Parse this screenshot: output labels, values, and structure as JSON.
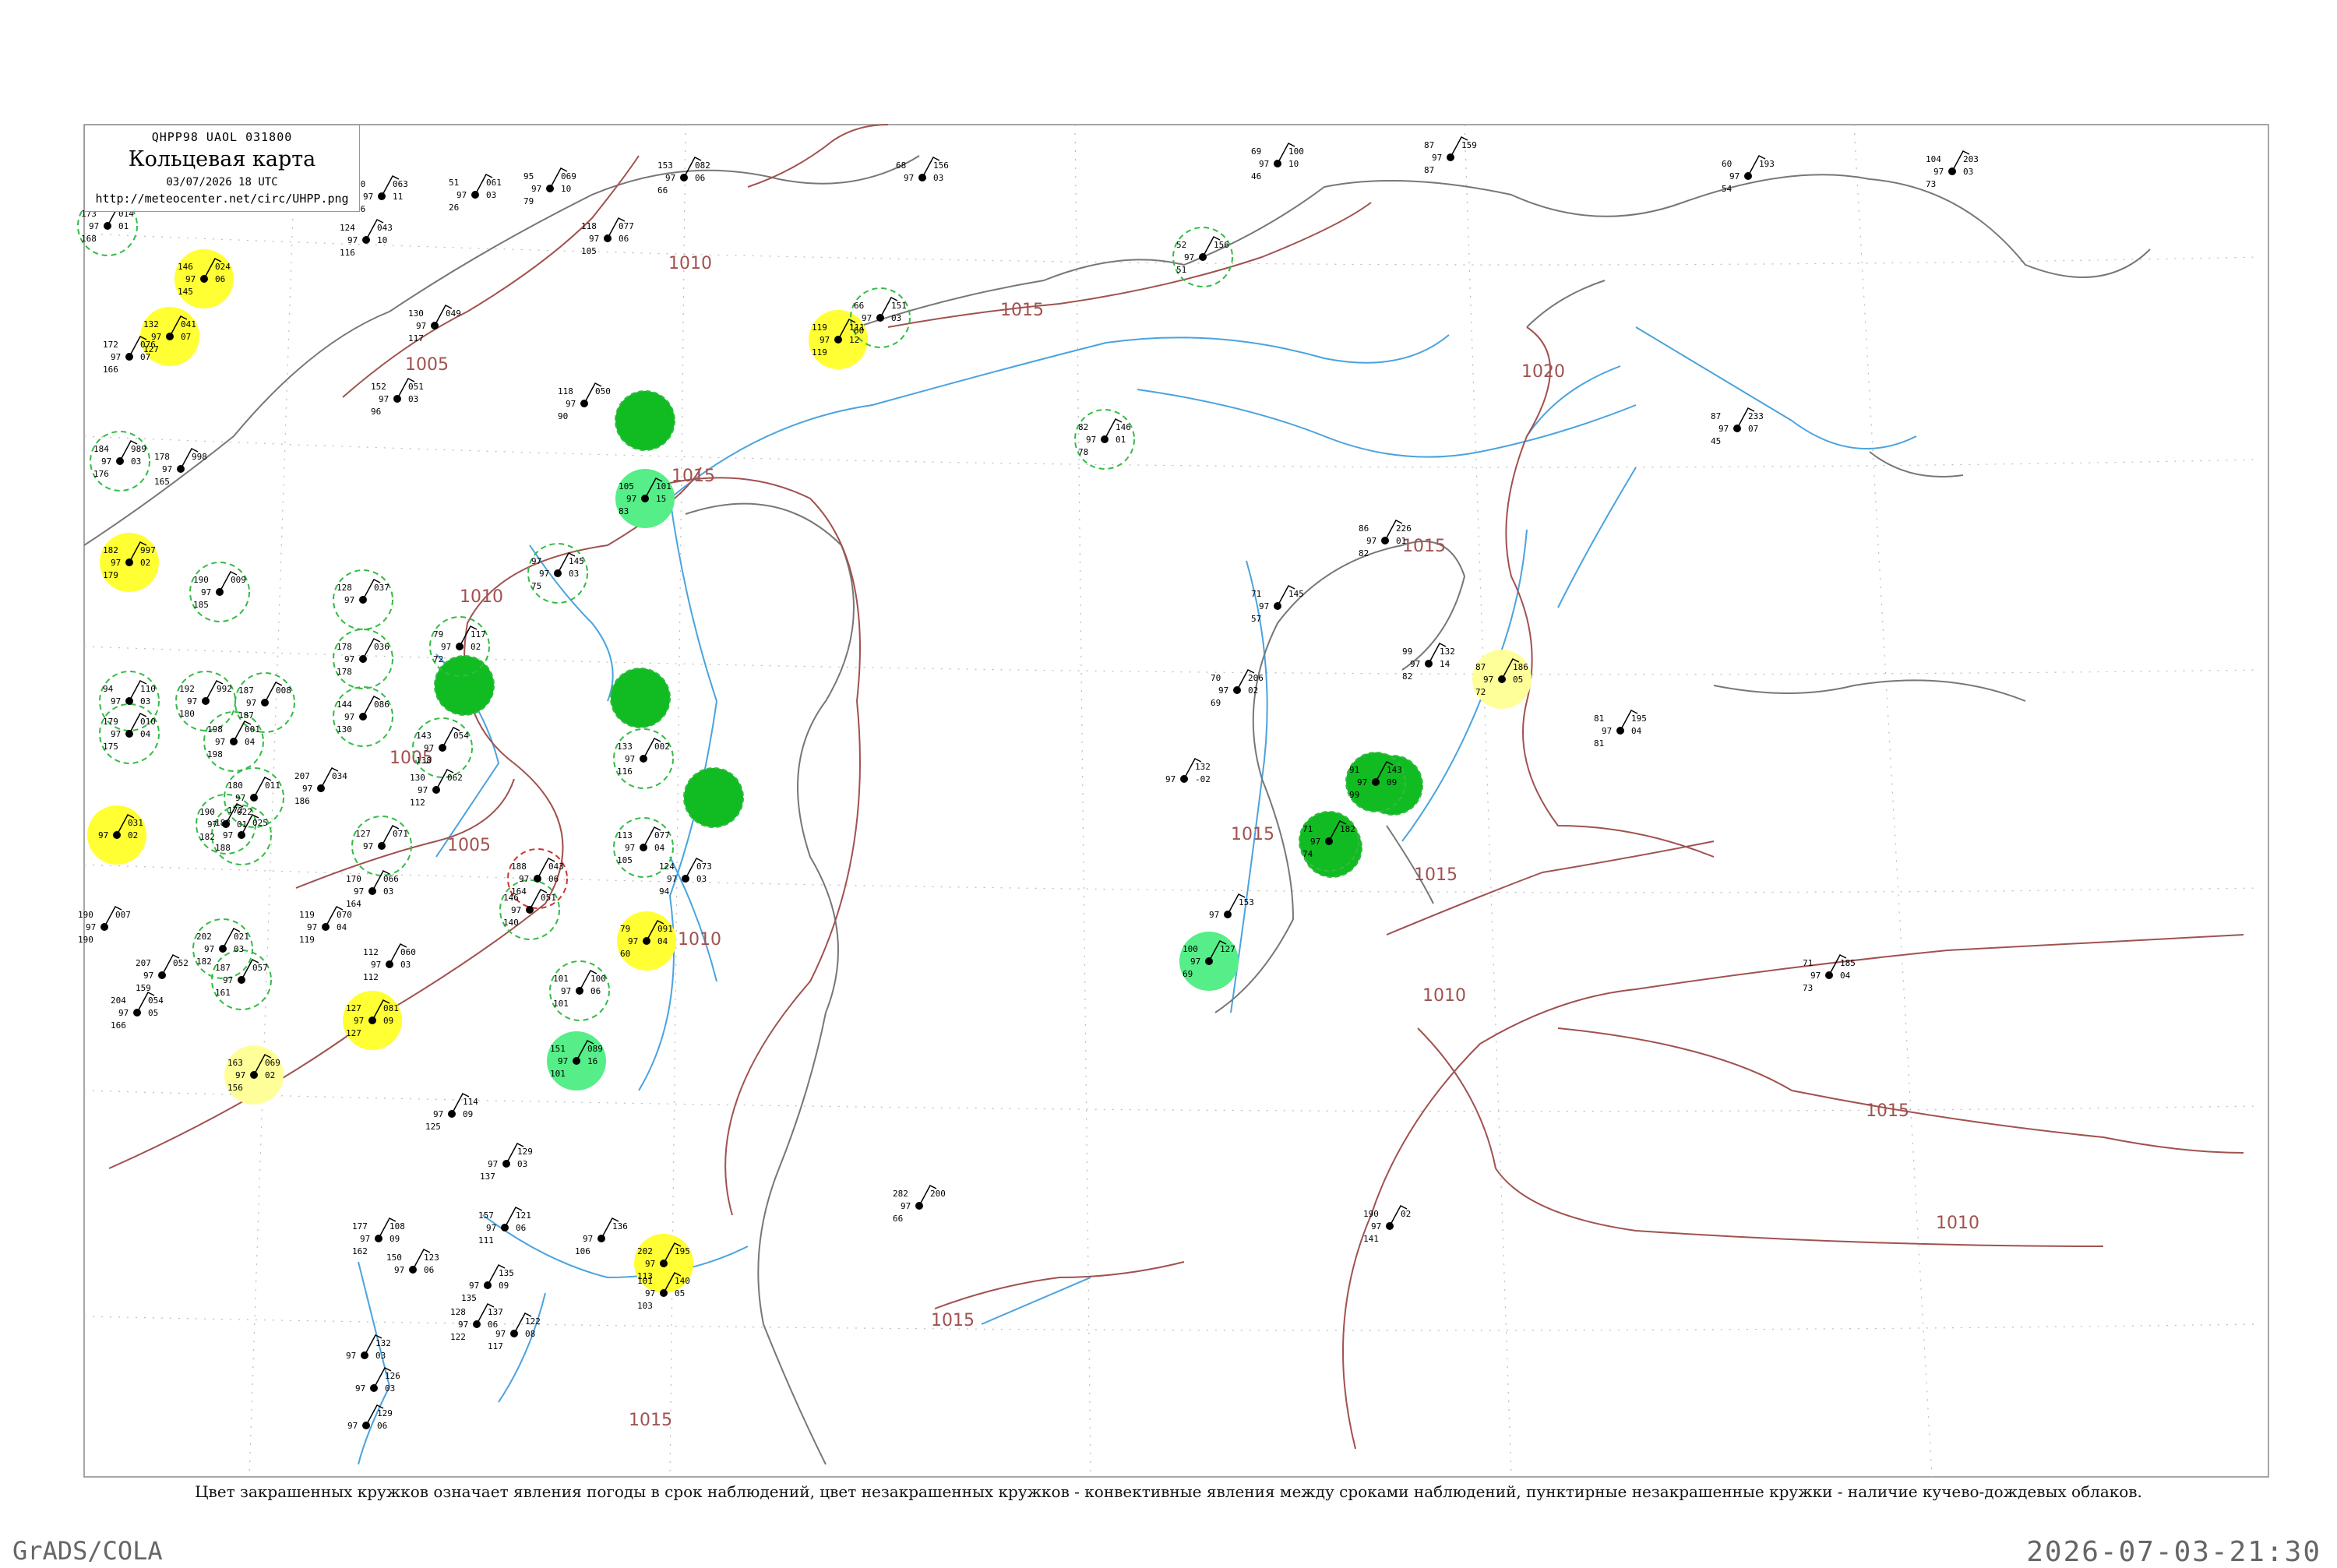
{
  "header": {
    "code_line": "QHPP98  UAOL  031800",
    "title": "Кольцевая карта",
    "date": "03/07/2026 18 UTC",
    "url": "http://meteocenter.net/circ/UHPP.png"
  },
  "caption": "Цвет закрашенных кружков означает явления погоды в срок наблюдений, цвет незакрашенных кружков - конвективные явления между сроками наблюдений, пунктирные незакрашенные кружки - наличие кучево-дождевых облаков.",
  "footer": {
    "left": "GrADS/COLA",
    "right": "2026-07-03-21:30"
  },
  "colors": {
    "isobar": "#a0524f",
    "water": "#4aa3df",
    "grid": "#bbbbbb",
    "yellow_fill": "#ffff33",
    "light_yellow_fill": "#ffff99",
    "green_fill": "#11bb22",
    "light_green_fill": "#55ee88",
    "dashed_green_circle": "#33bb44",
    "dashed_red_circle": "#cc3333"
  },
  "isobar_labels": [
    "1005",
    "1010",
    "1015",
    "1020"
  ],
  "stations": [
    {
      "p": "014",
      "t": "01",
      "n": "173",
      "td": "168"
    },
    {
      "p": "024",
      "t": "06",
      "n": "146",
      "td": "145"
    },
    {
      "p": "041",
      "t": "07",
      "n": "132",
      "td": "127"
    },
    {
      "p": "076",
      "t": "07",
      "n": "172",
      "td": "166"
    },
    {
      "p": "989",
      "t": "03",
      "n": "184",
      "td": "176"
    },
    {
      "p": "998",
      "t": "",
      "n": "178",
      "td": "165"
    },
    {
      "p": "997",
      "t": "02",
      "n": "182",
      "td": "179"
    },
    {
      "p": "009",
      "t": "",
      "n": "190",
      "td": "185"
    },
    {
      "p": "037",
      "t": "",
      "n": "128",
      "td": ""
    },
    {
      "p": "063",
      "t": "11",
      "n": "90",
      "td": "66"
    },
    {
      "p": "043",
      "t": "10",
      "n": "124",
      "td": "116"
    },
    {
      "p": "061",
      "t": "03",
      "n": "51",
      "td": "26"
    },
    {
      "p": "069",
      "t": "10",
      "n": "95",
      "td": "79"
    },
    {
      "p": "077",
      "t": "06",
      "n": "118",
      "td": "105"
    },
    {
      "p": "082",
      "t": "06",
      "n": "153",
      "td": "66"
    },
    {
      "p": "049",
      "t": "",
      "n": "130",
      "td": "117"
    },
    {
      "p": "051",
      "t": "03",
      "n": "152",
      "td": "96"
    },
    {
      "p": "050",
      "t": "",
      "n": "118",
      "td": "90"
    },
    {
      "p": "101",
      "t": "15",
      "n": "105",
      "td": "83"
    },
    {
      "p": "145",
      "t": "03",
      "n": "97",
      "td": "75"
    },
    {
      "p": "117",
      "t": "02",
      "n": "79",
      "td": "72"
    },
    {
      "p": "110",
      "t": "03",
      "n": "94",
      "td": ""
    },
    {
      "p": "992",
      "t": "",
      "n": "192",
      "td": "180"
    },
    {
      "p": "008",
      "t": "",
      "n": "187",
      "td": "187"
    },
    {
      "p": "010",
      "t": "04",
      "n": "179",
      "td": "175"
    },
    {
      "p": "001",
      "t": "04",
      "n": "198",
      "td": "198"
    },
    {
      "p": "011",
      "t": "",
      "n": "180",
      "td": "172"
    },
    {
      "p": "022",
      "t": "01",
      "n": "190",
      "td": "182"
    },
    {
      "p": "025",
      "t": "",
      "n": "188",
      "td": "188"
    },
    {
      "p": "031",
      "t": "02",
      "n": "",
      "td": ""
    },
    {
      "p": "007",
      "t": "",
      "n": "190",
      "td": "190"
    },
    {
      "p": "021",
      "t": "03",
      "n": "202",
      "td": "182"
    },
    {
      "p": "052",
      "t": "",
      "n": "207",
      "td": "159"
    },
    {
      "p": "054",
      "t": "05",
      "n": "204",
      "td": "166"
    },
    {
      "p": "057",
      "t": "",
      "n": "187",
      "td": "161"
    },
    {
      "p": "069",
      "t": "02",
      "n": "163",
      "td": "156"
    },
    {
      "p": "081",
      "t": "09",
      "n": "127",
      "td": "127"
    },
    {
      "p": "060",
      "t": "03",
      "n": "112",
      "td": "112"
    },
    {
      "p": "070",
      "t": "04",
      "n": "119",
      "td": "119"
    },
    {
      "p": "066",
      "t": "03",
      "n": "170",
      "td": "164"
    },
    {
      "p": "071",
      "t": "",
      "n": "127",
      "td": ""
    },
    {
      "p": "034",
      "t": "",
      "n": "207",
      "td": "186"
    },
    {
      "p": "036",
      "t": "",
      "n": "178",
      "td": "178"
    },
    {
      "p": "086",
      "t": "",
      "n": "144",
      "td": "130"
    },
    {
      "p": "054",
      "t": "",
      "n": "143",
      "td": "138"
    },
    {
      "p": "062",
      "t": "",
      "n": "130",
      "td": "112"
    },
    {
      "p": "043",
      "t": "06",
      "n": "188",
      "td": "164"
    },
    {
      "p": "051",
      "t": "",
      "n": "146",
      "td": "140"
    },
    {
      "p": "002",
      "t": "",
      "n": "133",
      "td": "116"
    },
    {
      "p": "077",
      "t": "04",
      "n": "113",
      "td": "105"
    },
    {
      "p": "073",
      "t": "03",
      "n": "124",
      "td": "94"
    },
    {
      "p": "091",
      "t": "04",
      "n": "79",
      "td": "60"
    },
    {
      "p": "100",
      "t": "06",
      "n": "101",
      "td": "101"
    },
    {
      "p": "089",
      "t": "16",
      "n": "151",
      "td": "101"
    },
    {
      "p": "111",
      "t": "12",
      "n": "119",
      "td": "119"
    },
    {
      "p": "151",
      "t": "03",
      "n": "66",
      "td": "60"
    },
    {
      "p": "156",
      "t": "03",
      "n": "68",
      "td": ""
    },
    {
      "p": "100",
      "t": "10",
      "n": "69",
      "td": "46"
    },
    {
      "p": "156",
      "t": "",
      "n": "52",
      "td": "51"
    },
    {
      "p": "146",
      "t": "01",
      "n": "82",
      "td": "78"
    },
    {
      "p": "159",
      "t": "",
      "n": "87",
      "td": "87"
    },
    {
      "p": "193",
      "t": "",
      "n": "60",
      "td": "54"
    },
    {
      "p": "203",
      "t": "03",
      "n": "104",
      "td": "73"
    },
    {
      "p": "233",
      "t": "07",
      "n": "87",
      "td": "45"
    },
    {
      "p": "226",
      "t": "01",
      "n": "86",
      "td": "82"
    },
    {
      "p": "145",
      "t": "",
      "n": "71",
      "td": "57"
    },
    {
      "p": "132",
      "t": "14",
      "n": "99",
      "td": "82"
    },
    {
      "p": "186",
      "t": "05",
      "n": "87",
      "td": "72"
    },
    {
      "p": "195",
      "t": "04",
      "n": "81",
      "td": "81"
    },
    {
      "p": "206",
      "t": "02",
      "n": "70",
      "td": "69"
    },
    {
      "p": "143",
      "t": "09",
      "n": "91",
      "td": "99"
    },
    {
      "p": "182",
      "t": "",
      "n": "71",
      "td": "74"
    },
    {
      "p": "153",
      "t": "",
      "n": "",
      "td": ""
    },
    {
      "p": "127",
      "t": "",
      "n": "100",
      "td": "69"
    },
    {
      "p": "185",
      "t": "04",
      "n": "71",
      "td": "73"
    },
    {
      "p": "200",
      "t": "",
      "n": "282",
      "td": "66"
    },
    {
      "p": "02",
      "t": "",
      "n": "190",
      "td": "141"
    },
    {
      "p": "195",
      "t": "",
      "n": "202",
      "td": "113"
    },
    {
      "p": "140",
      "t": "05",
      "n": "101",
      "td": "103"
    },
    {
      "p": "136",
      "t": "",
      "n": "",
      "td": "106"
    },
    {
      "p": "121",
      "t": "06",
      "n": "157",
      "td": "111"
    },
    {
      "p": "129",
      "t": "03",
      "n": "",
      "td": "137"
    },
    {
      "p": "114",
      "t": "09",
      "n": "",
      "td": "125"
    },
    {
      "p": "108",
      "t": "09",
      "n": "177",
      "td": "162"
    },
    {
      "p": "123",
      "t": "06",
      "n": "150",
      "td": ""
    },
    {
      "p": "135",
      "t": "09",
      "n": "",
      "td": "135"
    },
    {
      "p": "137",
      "t": "06",
      "n": "128",
      "td": "122"
    },
    {
      "p": "122",
      "t": "08",
      "n": "",
      "td": "117"
    },
    {
      "p": "132",
      "t": "03",
      "n": "",
      "td": ""
    },
    {
      "p": "126",
      "t": "03",
      "n": "",
      "td": ""
    },
    {
      "p": "129",
      "t": "06",
      "n": "",
      "td": ""
    },
    {
      "p": "132",
      "t": "-02",
      "n": "",
      "td": ""
    }
  ]
}
